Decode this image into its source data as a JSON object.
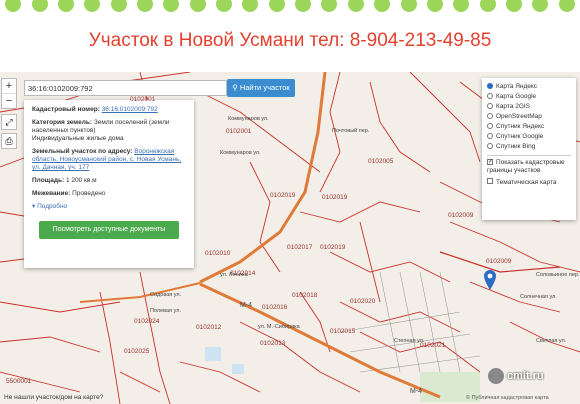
{
  "banner": {
    "title": "Участок в Новой Усмани тел: 8-904-213-49-85",
    "title_color": "#e4402e",
    "dot_color": "#9bd65b"
  },
  "controls": {
    "zoom_in": "+",
    "zoom_out": "−",
    "search_value": "36:16:0102009:792",
    "find_button": "Найти участок"
  },
  "info": {
    "cadastral_label": "Кадастровый номер:",
    "cadastral_value": "36:16:0102009:792",
    "category_label": "Категория земель:",
    "category_value": "Земли поселений (земли населенных пунктов)",
    "use_value": "Индивидуальные жилые дома",
    "address_label": "Земельный участок по адресу:",
    "address_value": "Воронежская область, Новоусманский район, с. Новая Усмань, ул. Дачная, уч. 177",
    "area_label": "Площадь:",
    "area_value": "1 200 кв.м",
    "mezhevanie_label": "Межевание:",
    "mezhevanie_value": "Проведено",
    "more_label": "Подробно",
    "docs_button": "Посмотреть доступные документы"
  },
  "layers": {
    "options": [
      {
        "label": "Карта Яндекс",
        "selected": true
      },
      {
        "label": "Карта Google",
        "selected": false
      },
      {
        "label": "Карта 2GIS",
        "selected": false
      },
      {
        "label": "OpenStreetMap",
        "selected": false
      },
      {
        "label": "Спутник Яндекс",
        "selected": false
      },
      {
        "label": "Спутник Google",
        "selected": false
      },
      {
        "label": "Спутник Bing",
        "selected": false
      }
    ],
    "show_borders": "Показать кадастровые границы участков",
    "thematic": "Тематическая карта"
  },
  "map_labels": {
    "q1": "0102001",
    "q2": "0102019",
    "q3": "0102005",
    "q4": "0102009",
    "q5": "0102010",
    "q6": "0102014",
    "q7": "0102012",
    "q8": "0102013",
    "q9": "0102016",
    "q10": "0102018",
    "q11": "0102021",
    "q12": "0102020",
    "q13": "0102017",
    "q14": "0102024",
    "q15": "0102025",
    "q16": "0102015",
    "q17": "5500001",
    "q18": "0102009"
  },
  "street_labels": {
    "s1": "Коммунаров ул.",
    "s2": "ул. Ленина",
    "s3": "Садовая ул.",
    "s4": "Степная ул.",
    "s5": "ул. М.-Сибиряка",
    "s6": "Полевая ул.",
    "s7": "Солнечная ул.",
    "s8": "Светлая ул.",
    "s9": "Почтовый пер.",
    "s10": "Соловьиное пер.",
    "s11": "М-4"
  },
  "footer": {
    "question": "Не нашли участок/дом на карте?",
    "attribution": "© Публичная кадастровая карта",
    "watermark": "cmlt.ru"
  }
}
